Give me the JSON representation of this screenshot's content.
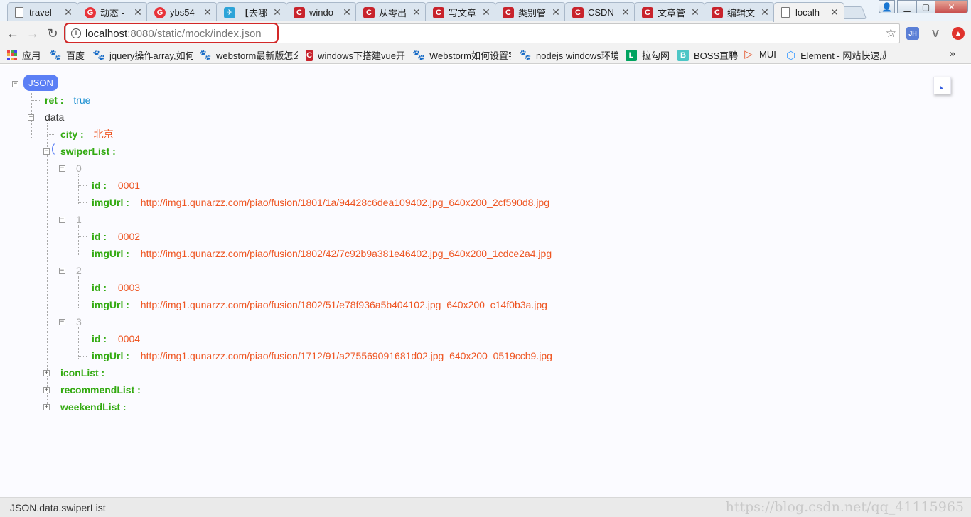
{
  "tabs": [
    {
      "label": "travel",
      "icon": "document-icon"
    },
    {
      "label": "动态 -",
      "icon": "g-logo-icon"
    },
    {
      "label": "ybs54",
      "icon": "g-logo-icon"
    },
    {
      "label": "【去哪",
      "icon": "bird-icon"
    },
    {
      "label": "windo",
      "icon": "csdn-icon"
    },
    {
      "label": "从零出",
      "icon": "csdn-icon"
    },
    {
      "label": "写文章",
      "icon": "csdn-icon"
    },
    {
      "label": "类别管",
      "icon": "csdn-icon"
    },
    {
      "label": "CSDN",
      "icon": "csdn-icon"
    },
    {
      "label": "文章管",
      "icon": "csdn-icon"
    },
    {
      "label": "编辑文",
      "icon": "csdn-icon"
    },
    {
      "label": "localh",
      "icon": "document-icon"
    }
  ],
  "address": {
    "host": "localhost",
    "rest": ":8080/static/mock/index.json"
  },
  "extensions": [
    "JH",
    "V"
  ],
  "bookmarks": [
    {
      "label": "应用",
      "icon": "apps-grid-icon"
    },
    {
      "label": "百度",
      "icon": "paw-icon"
    },
    {
      "label": "jquery操作array,如何",
      "icon": "paw-icon"
    },
    {
      "label": "webstorm最新版怎么",
      "icon": "paw-icon"
    },
    {
      "label": "windows下搭建vue开",
      "icon": "csdn-icon"
    },
    {
      "label": "Webstorm如何设置字",
      "icon": "paw-icon"
    },
    {
      "label": "nodejs windows环境",
      "icon": "paw-icon"
    },
    {
      "label": "拉勾网",
      "icon": "lagou-icon"
    },
    {
      "label": "BOSS直聘",
      "icon": "boss-icon"
    },
    {
      "label": "MUI",
      "icon": "mui-icon"
    },
    {
      "label": "Element - 网站快速成",
      "icon": "element-icon"
    }
  ],
  "tree": {
    "root": "JSON",
    "ret": {
      "key": "ret :",
      "value": "true"
    },
    "data_label": "data",
    "city": {
      "key": "city :",
      "value": "北京"
    },
    "swiper_label": "swiperList :",
    "items": [
      {
        "index": "0",
        "id_key": "id :",
        "id": "0001",
        "url_key": "imgUrl :",
        "url": "http://img1.qunarzz.com/piao/fusion/1801/1a/94428c6dea109402.jpg_640x200_2cf590d8.jpg"
      },
      {
        "index": "1",
        "id_key": "id :",
        "id": "0002",
        "url_key": "imgUrl :",
        "url": "http://img1.qunarzz.com/piao/fusion/1802/42/7c92b9a381e46402.jpg_640x200_1cdce2a4.jpg"
      },
      {
        "index": "2",
        "id_key": "id :",
        "id": "0003",
        "url_key": "imgUrl :",
        "url": "http://img1.qunarzz.com/piao/fusion/1802/51/e78f936a5b404102.jpg_640x200_c14f0b3a.jpg"
      },
      {
        "index": "3",
        "id_key": "id :",
        "id": "0004",
        "url_key": "imgUrl :",
        "url": "http://img1.qunarzz.com/piao/fusion/1712/91/a275569091681d02.jpg_640x200_0519ccb9.jpg"
      }
    ],
    "collapsed": [
      "iconList :",
      "recommendList :",
      "weekendList :"
    ]
  },
  "status": {
    "path": "JSON.data.swiperList",
    "watermark": "https://blog.csdn.net/qq_41115965"
  },
  "colors": {
    "key": "#33aa11",
    "string": "#ee5522",
    "boolean": "#1a8fd0",
    "accent": "#5b7ff5",
    "highlight": "#d32828"
  }
}
